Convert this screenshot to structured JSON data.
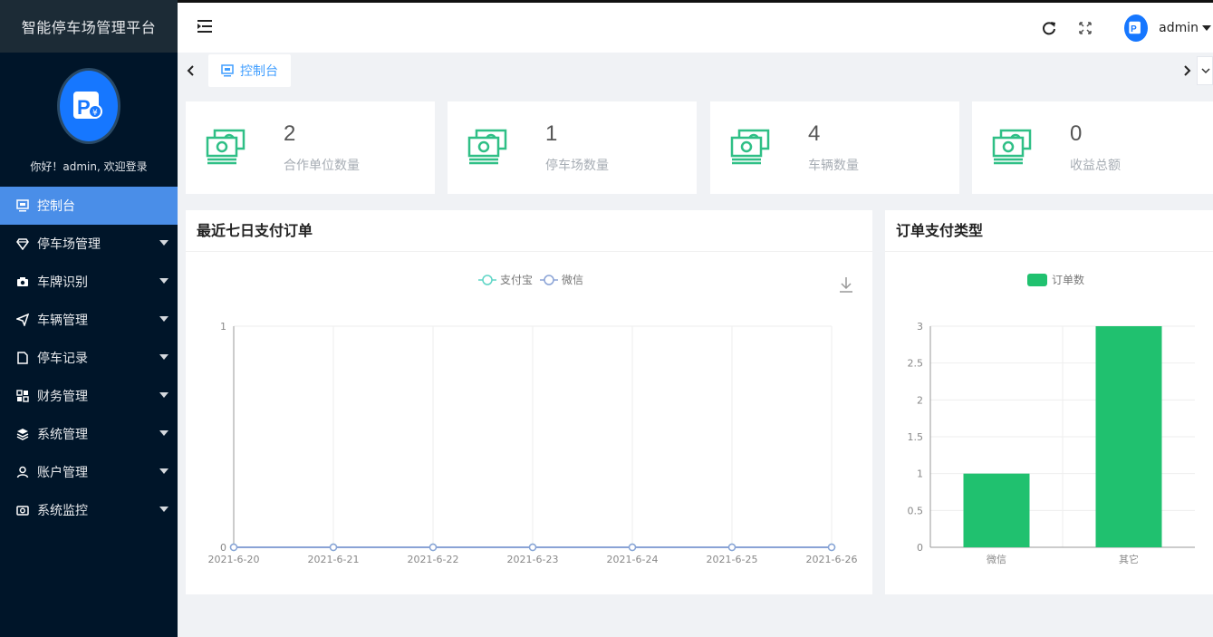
{
  "app": {
    "title": "智能停车场管理平台"
  },
  "sidebar": {
    "welcome": "你好！admin, 欢迎登录",
    "items": [
      {
        "label": "控制台",
        "icon": "monitor-icon",
        "active": true,
        "has_caret": false
      },
      {
        "label": "停车场管理",
        "icon": "diamond-icon",
        "has_caret": true
      },
      {
        "label": "车牌识别",
        "icon": "camera-icon",
        "has_caret": true
      },
      {
        "label": "车辆管理",
        "icon": "send-icon",
        "has_caret": true
      },
      {
        "label": "停车记录",
        "icon": "document-icon",
        "has_caret": true
      },
      {
        "label": "财务管理",
        "icon": "grid-icon",
        "has_caret": true
      },
      {
        "label": "系统管理",
        "icon": "layers-icon",
        "has_caret": true
      },
      {
        "label": "账户管理",
        "icon": "user-icon",
        "has_caret": true
      },
      {
        "label": "系统监控",
        "icon": "camera-alt-icon",
        "has_caret": true
      }
    ]
  },
  "header": {
    "username": "admin"
  },
  "tabs": [
    {
      "label": "控制台",
      "icon": "monitor-icon"
    }
  ],
  "stats": [
    {
      "value": "2",
      "label": "合作单位数量"
    },
    {
      "value": "1",
      "label": "停车场数量"
    },
    {
      "value": "4",
      "label": "车辆数量"
    },
    {
      "value": "0",
      "label": "收益总额"
    }
  ],
  "colors": {
    "accent": "#4a8ee8",
    "sidebar_bg": "#001529",
    "money_green": "#2fbf86",
    "bar_green": "#20c16f"
  },
  "line_panel": {
    "title": "最近七日支付订单"
  },
  "bar_panel": {
    "title": "订单支付类型"
  },
  "chart_data": [
    {
      "type": "line",
      "title": "",
      "xlabel": "",
      "ylabel": "",
      "x": [
        "2021-6-20",
        "2021-6-21",
        "2021-6-22",
        "2021-6-23",
        "2021-6-24",
        "2021-6-25",
        "2021-6-26"
      ],
      "series": [
        {
          "name": "支付宝",
          "values": [
            0,
            0,
            0,
            0,
            0,
            0,
            0
          ],
          "color": "#5ed5c6"
        },
        {
          "name": "微信",
          "values": [
            0,
            0,
            0,
            0,
            0,
            0,
            0
          ],
          "color": "#8aa3d6"
        }
      ],
      "ylim": [
        0,
        1
      ],
      "yticks": [
        "0",
        "1"
      ],
      "grid": true,
      "legend": "top-center"
    },
    {
      "type": "bar",
      "title": "",
      "categories": [
        "微信",
        "其它"
      ],
      "series": [
        {
          "name": "订单数",
          "values": [
            1,
            3
          ],
          "color": "#20c16f"
        }
      ],
      "ylim": [
        0,
        3
      ],
      "yticks": [
        "0",
        "0.5",
        "1",
        "1.5",
        "2",
        "2.5",
        "3"
      ],
      "grid": true,
      "legend": "top-center"
    }
  ]
}
